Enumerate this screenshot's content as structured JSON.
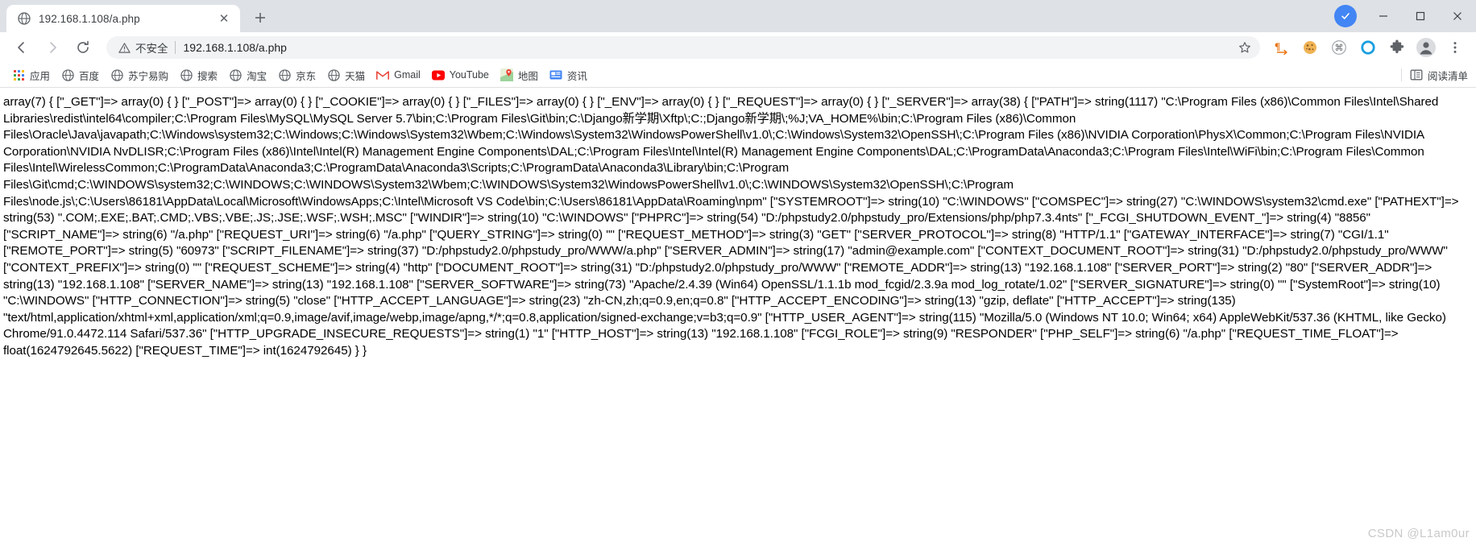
{
  "window": {
    "minimize_label": "—",
    "maximize_label": "▢",
    "close_label": "✕"
  },
  "tabstrip": {
    "tabs": [
      {
        "title": "192.168.1.108/a.php",
        "favicon": "globe-icon",
        "close_label": "✕"
      }
    ],
    "new_tab_label": "+"
  },
  "toolbar": {
    "back_label": "←",
    "forward_label": "→",
    "reload_label": "⟳",
    "security_text": "不安全",
    "url": "192.168.1.108/a.php",
    "star_label": "☆",
    "extensions": [
      {
        "name": "pilcrow-translate-icon",
        "glyph": "¶"
      },
      {
        "name": "cookie-icon",
        "glyph": "🍪"
      },
      {
        "name": "command-icon",
        "glyph": "⌘"
      },
      {
        "name": "ring-icon",
        "glyph": "◯"
      },
      {
        "name": "puzzle-extensions-icon",
        "glyph": "🧩"
      },
      {
        "name": "profile-avatar-icon",
        "glyph": "👤"
      },
      {
        "name": "more-menu-icon",
        "glyph": "⋮"
      }
    ]
  },
  "bookmarks": {
    "items": [
      {
        "label": "应用",
        "icon": "apps-grid-icon"
      },
      {
        "label": "百度",
        "icon": "globe-icon"
      },
      {
        "label": "苏宁易购",
        "icon": "globe-icon"
      },
      {
        "label": "搜索",
        "icon": "globe-icon"
      },
      {
        "label": "淘宝",
        "icon": "globe-icon"
      },
      {
        "label": "京东",
        "icon": "globe-icon"
      },
      {
        "label": "天猫",
        "icon": "globe-icon"
      },
      {
        "label": "Gmail",
        "icon": "gmail-icon"
      },
      {
        "label": "YouTube",
        "icon": "youtube-icon"
      },
      {
        "label": "地图",
        "icon": "maps-pin-icon"
      },
      {
        "label": "资讯",
        "icon": "news-icon"
      }
    ],
    "reading_list_label": "阅读清单",
    "reading_list_icon": "reading-list-icon"
  },
  "content": {
    "dump": "array(7) { [\"_GET\"]=> array(0) { } [\"_POST\"]=> array(0) { } [\"_COOKIE\"]=> array(0) { } [\"_FILES\"]=> array(0) { } [\"_ENV\"]=> array(0) { } [\"_REQUEST\"]=> array(0) { } [\"_SERVER\"]=> array(38) { [\"PATH\"]=> string(1117) \"C:\\Program Files (x86)\\Common Files\\Intel\\Shared Libraries\\redist\\intel64\\compiler;C:\\Program Files\\MySQL\\MySQL Server 5.7\\bin;C:\\Program Files\\Git\\bin;C:\\Django新学期\\Xftp\\;C:;Django新学期\\;%J;VA_HOME%\\bin;C:\\Program Files (x86)\\Common Files\\Oracle\\Java\\javapath;C:\\Windows\\system32;C:\\Windows;C:\\Windows\\System32\\Wbem;C:\\Windows\\System32\\WindowsPowerShell\\v1.0\\;C:\\Windows\\System32\\OpenSSH\\;C:\\Program Files (x86)\\NVIDIA Corporation\\PhysX\\Common;C:\\Program Files\\NVIDIA Corporation\\NVIDIA NvDLISR;C:\\Program Files (x86)\\Intel\\Intel(R) Management Engine Components\\DAL;C:\\Program Files\\Intel\\Intel(R) Management Engine Components\\DAL;C:\\ProgramData\\Anaconda3;C:\\Program Files\\Intel\\WiFi\\bin;C:\\Program Files\\Common Files\\Intel\\WirelessCommon;C:\\ProgramData\\Anaconda3;C:\\ProgramData\\Anaconda3\\Scripts;C:\\ProgramData\\Anaconda3\\Library\\bin;C:\\Program Files\\Git\\cmd;C:\\WINDOWS\\system32;C:\\WINDOWS;C:\\WINDOWS\\System32\\Wbem;C:\\WINDOWS\\System32\\WindowsPowerShell\\v1.0\\;C:\\WINDOWS\\System32\\OpenSSH\\;C:\\Program Files\\node.js\\;C:\\Users\\86181\\AppData\\Local\\Microsoft\\WindowsApps;C:\\Intel\\Microsoft VS Code\\bin;C:\\Users\\86181\\AppData\\Roaming\\npm\" [\"SYSTEMROOT\"]=> string(10) \"C:\\WINDOWS\" [\"COMSPEC\"]=> string(27) \"C:\\WINDOWS\\system32\\cmd.exe\" [\"PATHEXT\"]=> string(53) \".COM;.EXE;.BAT;.CMD;.VBS;.VBE;.JS;.JSE;.WSF;.WSH;.MSC\" [\"WINDIR\"]=> string(10) \"C:\\WINDOWS\" [\"PHPRC\"]=> string(54) \"D:/phpstudy2.0/phpstudy_pro/Extensions/php/php7.3.4nts\" [\"_FCGI_SHUTDOWN_EVENT_\"]=> string(4) \"8856\" [\"SCRIPT_NAME\"]=> string(6) \"/a.php\" [\"REQUEST_URI\"]=> string(6) \"/a.php\" [\"QUERY_STRING\"]=> string(0) \"\" [\"REQUEST_METHOD\"]=> string(3) \"GET\" [\"SERVER_PROTOCOL\"]=> string(8) \"HTTP/1.1\" [\"GATEWAY_INTERFACE\"]=> string(7) \"CGI/1.1\" [\"REMOTE_PORT\"]=> string(5) \"60973\" [\"SCRIPT_FILENAME\"]=> string(37) \"D:/phpstudy2.0/phpstudy_pro/WWW/a.php\" [\"SERVER_ADMIN\"]=> string(17) \"admin@example.com\" [\"CONTEXT_DOCUMENT_ROOT\"]=> string(31) \"D:/phpstudy2.0/phpstudy_pro/WWW\" [\"CONTEXT_PREFIX\"]=> string(0) \"\" [\"REQUEST_SCHEME\"]=> string(4) \"http\" [\"DOCUMENT_ROOT\"]=> string(31) \"D:/phpstudy2.0/phpstudy_pro/WWW\" [\"REMOTE_ADDR\"]=> string(13) \"192.168.1.108\" [\"SERVER_PORT\"]=> string(2) \"80\" [\"SERVER_ADDR\"]=> string(13) \"192.168.1.108\" [\"SERVER_NAME\"]=> string(13) \"192.168.1.108\" [\"SERVER_SOFTWARE\"]=> string(73) \"Apache/2.4.39 (Win64) OpenSSL/1.1.1b mod_fcgid/2.3.9a mod_log_rotate/1.02\" [\"SERVER_SIGNATURE\"]=> string(0) \"\" [\"SystemRoot\"]=> string(10) \"C:\\WINDOWS\" [\"HTTP_CONNECTION\"]=> string(5) \"close\" [\"HTTP_ACCEPT_LANGUAGE\"]=> string(23) \"zh-CN,zh;q=0.9,en;q=0.8\" [\"HTTP_ACCEPT_ENCODING\"]=> string(13) \"gzip, deflate\" [\"HTTP_ACCEPT\"]=> string(135) \"text/html,application/xhtml+xml,application/xml;q=0.9,image/avif,image/webp,image/apng,*/*;q=0.8,application/signed-exchange;v=b3;q=0.9\" [\"HTTP_USER_AGENT\"]=> string(115) \"Mozilla/5.0 (Windows NT 10.0; Win64; x64) AppleWebKit/537.36 (KHTML, like Gecko) Chrome/91.0.4472.114 Safari/537.36\" [\"HTTP_UPGRADE_INSECURE_REQUESTS\"]=> string(1) \"1\" [\"HTTP_HOST\"]=> string(13) \"192.168.1.108\" [\"FCGI_ROLE\"]=> string(9) \"RESPONDER\" [\"PHP_SELF\"]=> string(6) \"/a.php\" [\"REQUEST_TIME_FLOAT\"]=> float(1624792645.5622) [\"REQUEST_TIME\"]=> int(1624792645) } }"
  },
  "watermark": {
    "text": "CSDN @L1am0ur"
  },
  "colors": {
    "tabstrip_bg": "#dee1e6",
    "omnibox_bg": "#f1f3f4",
    "text": "#3c4043",
    "accent_blue": "#4285f4",
    "gmail_red": "#ea4335",
    "youtube_red": "#ff0000",
    "watermark_gray": "#c9c9c9"
  }
}
